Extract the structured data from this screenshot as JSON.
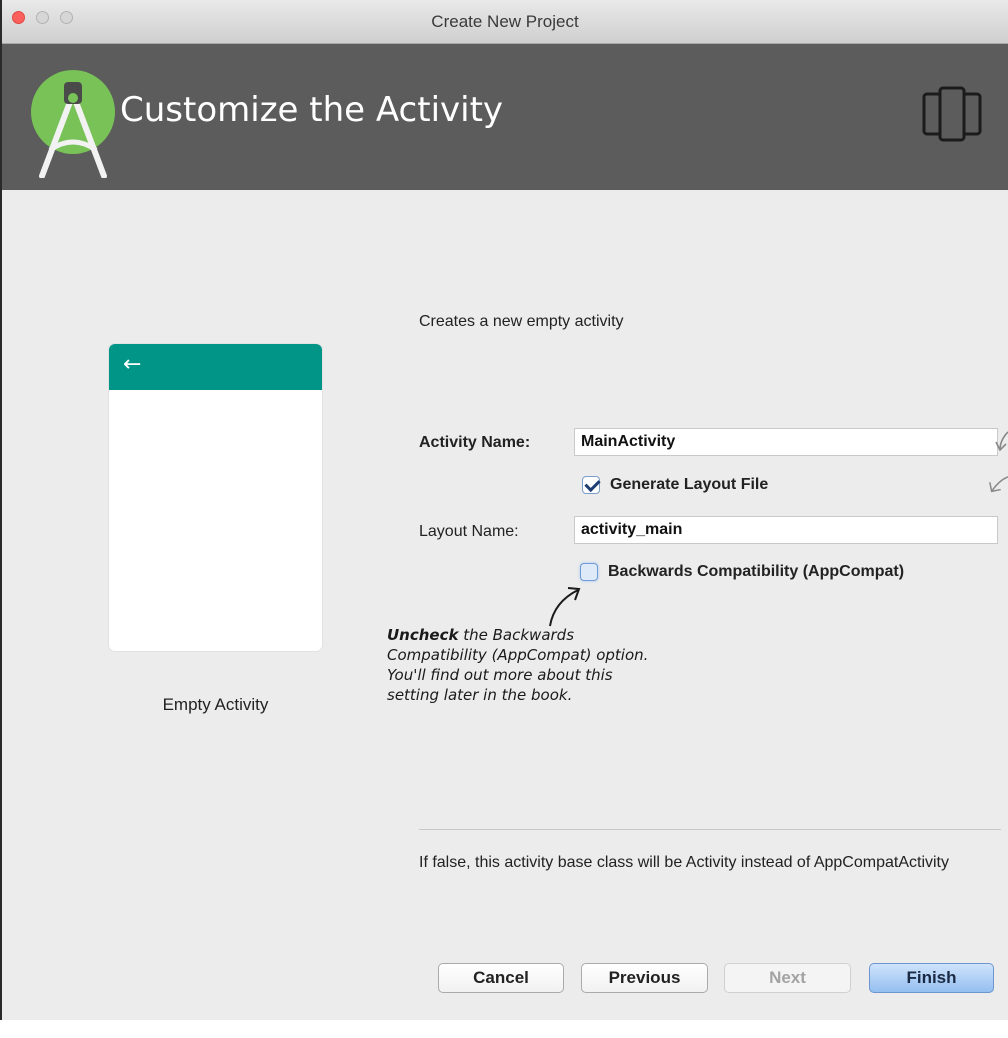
{
  "window": {
    "title": "Create New Project"
  },
  "header": {
    "title": "Customize the Activity"
  },
  "template": {
    "name": "Empty Activity"
  },
  "description": "Creates a new empty activity",
  "form": {
    "activity_name_label": "Activity Name:",
    "activity_name_value": "MainActivity",
    "generate_layout_label": "Generate Layout File",
    "generate_layout_checked": true,
    "layout_name_label": "Layout Name:",
    "layout_name_value": "activity_main",
    "backwards_compat_label": "Backwards Compatibility (AppCompat)",
    "backwards_compat_checked": false
  },
  "annotation": {
    "strong": "Uncheck",
    "line1_rest": " the Backwards",
    "line2": "Compatibility (AppCompat) option.",
    "line3": "You'll find out more about this",
    "line4": "setting later in the book."
  },
  "help_text": "If false, this activity base class will be Activity instead of AppCompatActivity",
  "buttons": {
    "cancel": "Cancel",
    "previous": "Previous",
    "next": "Next",
    "finish": "Finish"
  },
  "colors": {
    "header_bg": "#5c5c5c",
    "preview_bar": "#009587",
    "finish_accent": "#94bff0"
  },
  "icons": {
    "logo": "android-studio-logo-icon",
    "device": "device-layout-icon",
    "back": "back-arrow-icon"
  }
}
